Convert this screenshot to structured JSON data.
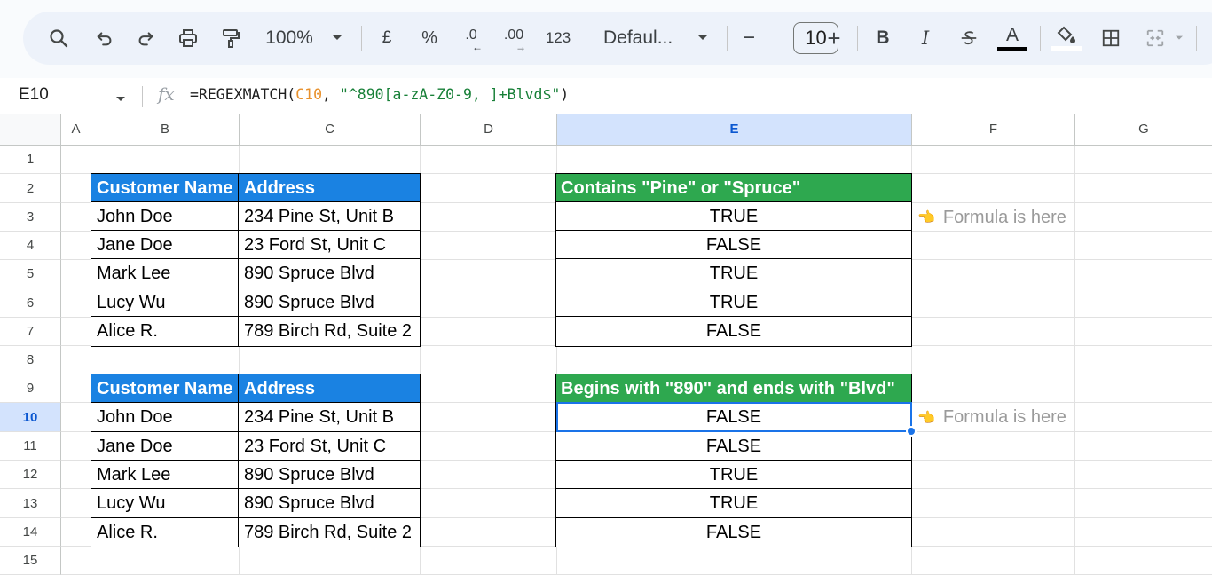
{
  "toolbar": {
    "zoom": "100%",
    "currency": "£",
    "percent": "%",
    "dec_decrease": ".0",
    "dec_increase": ".00",
    "number_format": "123",
    "font_name": "Defaul...",
    "font_size": "10",
    "minus": "−",
    "plus": "+",
    "bold": "B",
    "italic": "I",
    "text_color_letter": "A",
    "colors": {
      "text_color_bar": "#000000",
      "accent": "#0b57d0"
    }
  },
  "formula_bar": {
    "cell_ref": "E10",
    "fx": "fx",
    "formula_prefix": "=REGEXMATCH(",
    "formula_ref": "C10",
    "formula_mid": ", ",
    "formula_str": "\"^890[a-zA-Z0-9, ]+Blvd$\"",
    "formula_suffix": ")"
  },
  "columns": [
    "A",
    "B",
    "C",
    "D",
    "E",
    "F",
    "G"
  ],
  "rows": [
    "1",
    "2",
    "3",
    "4",
    "5",
    "6",
    "7",
    "8",
    "9",
    "10",
    "11",
    "12",
    "13",
    "14",
    "15"
  ],
  "table1": {
    "headers": [
      "Customer Name",
      "Address"
    ],
    "rows": [
      [
        "John Doe",
        "234 Pine St, Unit B"
      ],
      [
        "Jane Doe",
        "23 Ford St, Unit C"
      ],
      [
        "Mark Lee",
        "890 Spruce Blvd"
      ],
      [
        "Lucy Wu",
        "890 Spruce Blvd"
      ],
      [
        "Alice R.",
        "789 Birch Rd, Suite 2"
      ]
    ],
    "result_header": "Contains \"Pine\" or \"Spruce\"",
    "results": [
      "TRUE",
      "FALSE",
      "TRUE",
      "TRUE",
      "FALSE"
    ]
  },
  "table2": {
    "headers": [
      "Customer Name",
      "Address"
    ],
    "rows": [
      [
        "John Doe",
        "234 Pine St, Unit B"
      ],
      [
        "Jane Doe",
        "23 Ford St, Unit C"
      ],
      [
        "Mark Lee",
        "890 Spruce Blvd"
      ],
      [
        "Lucy Wu",
        "890 Spruce Blvd"
      ],
      [
        "Alice R.",
        "789 Birch Rd, Suite 2"
      ]
    ],
    "result_header": "Begins with \"890\" and ends with \"Blvd\"",
    "results": [
      "FALSE",
      "FALSE",
      "TRUE",
      "TRUE",
      "FALSE"
    ]
  },
  "notes": {
    "note1": "Formula is here",
    "note2": "Formula is here",
    "pointer_glyph": "👈"
  },
  "colors": {
    "header_blue": "#1a82e2",
    "header_green": "#2ea84f",
    "selection": "#1a73e8"
  }
}
